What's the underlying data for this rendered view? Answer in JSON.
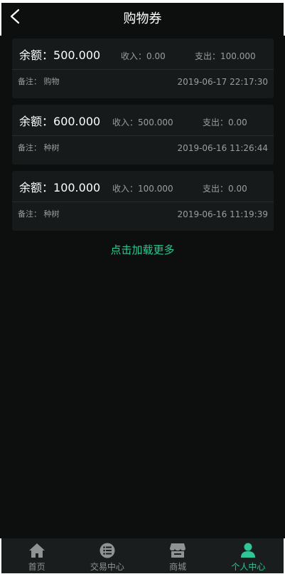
{
  "header": {
    "title": "购物券"
  },
  "records": [
    {
      "balance_label": "余额：",
      "balance": "500.000",
      "income": "收入：0.00",
      "expense": "支出：100.000",
      "remark": "备注：  购物",
      "time": "2019-06-17 22:17:30"
    },
    {
      "balance_label": "余额：",
      "balance": "600.000",
      "income": "收入：500.000",
      "expense": "支出：0.00",
      "remark": "备注：  种树",
      "time": "2019-06-16 11:26:44"
    },
    {
      "balance_label": "余额：",
      "balance": "100.000",
      "income": "收入：100.000",
      "expense": "支出：0.00",
      "remark": "备注：  种树",
      "time": "2019-06-16 11:19:39"
    }
  ],
  "load_more": "点击加载更多",
  "tabs": [
    {
      "label": "首页",
      "icon": "home-icon",
      "active": false
    },
    {
      "label": "交易中心",
      "icon": "list-icon",
      "active": false
    },
    {
      "label": "商城",
      "icon": "store-icon",
      "active": false
    },
    {
      "label": "个人中心",
      "icon": "user-icon",
      "active": true
    }
  ],
  "colors": {
    "background": "#0d0e0e",
    "card": "#161a1a",
    "accent": "#2fc596",
    "muted_text": "#9a9e9e",
    "tabbar": "#1a1d1d"
  }
}
